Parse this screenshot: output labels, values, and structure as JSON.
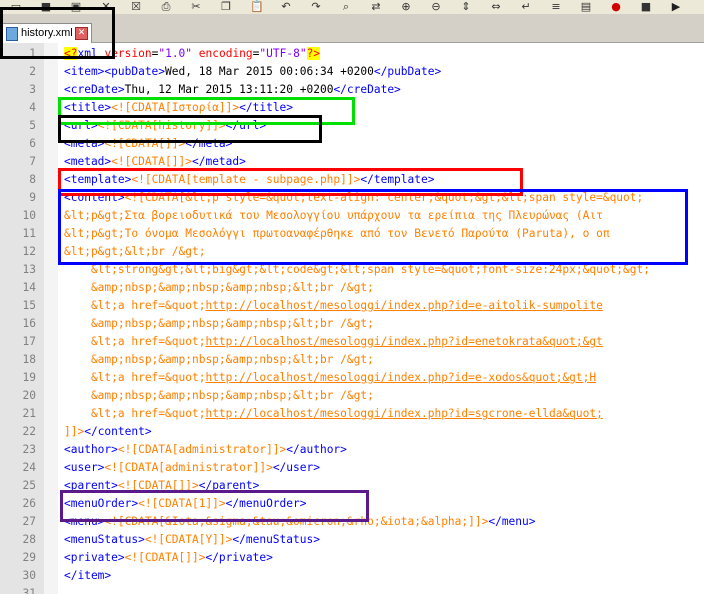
{
  "tab": {
    "label": "history.xml",
    "close": "✕"
  },
  "toolbar": {
    "icons": [
      "folder-icon",
      "save-icon",
      "save-all-icon",
      "close-icon",
      "close-all-icon",
      "print-icon",
      "cut-icon",
      "copy-icon",
      "paste-icon",
      "undo-icon",
      "redo-icon",
      "find-icon",
      "replace-icon",
      "zoom-in-icon",
      "zoom-out-icon",
      "sync-v-icon",
      "sync-h-icon",
      "wrap-icon",
      "indent-icon",
      "highlight-icon",
      "record-icon",
      "stop-icon",
      "play-icon"
    ]
  },
  "lines": [
    {
      "n": "1",
      "segs": [
        [
          "pi",
          "<?"
        ],
        [
          "tag",
          "xml "
        ],
        [
          "attr",
          "version"
        ],
        [
          "txt",
          "="
        ],
        [
          "val",
          "\"1.0\" "
        ],
        [
          "attr",
          "encoding"
        ],
        [
          "txt",
          "="
        ],
        [
          "val",
          "\"UTF-8\""
        ],
        [
          "pi",
          "?>"
        ]
      ]
    },
    {
      "n": "2",
      "segs": [
        [
          "tag",
          "<item><pubDate>"
        ],
        [
          "txt",
          "Wed, 18 Mar 2015 00:06:34 +0200"
        ],
        [
          "tag",
          "</pubDate>"
        ]
      ]
    },
    {
      "n": "3",
      "segs": [
        [
          "tag",
          "<creDate>"
        ],
        [
          "txt",
          "Thu, 12 Mar 2015 13:11:20 +0200"
        ],
        [
          "tag",
          "</creDate>"
        ]
      ]
    },
    {
      "n": "4",
      "segs": [
        [
          "tag",
          "<title>"
        ],
        [
          "cd",
          "<![CDATA[Ιστορία]]>"
        ],
        [
          "tag",
          "</title>"
        ]
      ]
    },
    {
      "n": "5",
      "segs": [
        [
          "tag",
          "<url>"
        ],
        [
          "cd",
          "<![CDATA[history]]>"
        ],
        [
          "tag",
          "</url>"
        ]
      ]
    },
    {
      "n": "6",
      "segs": [
        [
          "tag",
          "<meta>"
        ],
        [
          "cd",
          "<![CDATA[]]>"
        ],
        [
          "tag",
          "</meta>"
        ]
      ]
    },
    {
      "n": "7",
      "segs": [
        [
          "tag",
          "<metad>"
        ],
        [
          "cd",
          "<![CDATA[]]>"
        ],
        [
          "tag",
          "</metad>"
        ]
      ]
    },
    {
      "n": "8",
      "segs": [
        [
          "tag",
          "<template>"
        ],
        [
          "cd",
          "<![CDATA[template - subpage.php]]>"
        ],
        [
          "tag",
          "</template>"
        ]
      ]
    },
    {
      "n": "9",
      "segs": [
        [
          "tag",
          "<content>"
        ],
        [
          "cd",
          "<![CDATA[&lt;p style=&quot;text-align: center;&quot;&gt;&lt;span style=&quot;"
        ]
      ]
    },
    {
      "n": "10",
      "segs": [
        [
          "cd",
          "&lt;p&gt;Στα βορειοδυτικά του Μεσολογγίου υπάρχουν τα ερείπια της Πλευρώνας (Αιτ"
        ]
      ]
    },
    {
      "n": "11",
      "segs": [
        [
          "cd",
          "&lt;p&gt;Το όνομα Μεσολόγγι πρωτοαναφέρθηκε από τον Βενετό Παρούτα (Paruta), ο οπ"
        ]
      ]
    },
    {
      "n": "12",
      "segs": [
        [
          "cd",
          "&lt;p&gt;&lt;br /&gt;"
        ]
      ]
    },
    {
      "n": "13",
      "segs": [
        [
          "cd",
          "    &lt;strong&gt;&lt;big&gt;&lt;code&gt;&lt;span style=&quot;font-size:24px;&quot;&gt;"
        ]
      ]
    },
    {
      "n": "14",
      "segs": [
        [
          "cd",
          "    &amp;nbsp;&amp;nbsp;&amp;nbsp;&lt;br /&gt;"
        ]
      ]
    },
    {
      "n": "15",
      "segs": [
        [
          "cd",
          "    &lt;a href=&quot;"
        ],
        [
          "link",
          "http://localhost/mesologgi/index.php?id=e-aitolik-sumpolite"
        ]
      ]
    },
    {
      "n": "16",
      "segs": [
        [
          "cd",
          "    &amp;nbsp;&amp;nbsp;&amp;nbsp;&lt;br /&gt;"
        ]
      ]
    },
    {
      "n": "17",
      "segs": [
        [
          "cd",
          "    &lt;a href=&quot;"
        ],
        [
          "link",
          "http://localhost/mesologgi/index.php?id=enetokrata&quot;&gt"
        ]
      ]
    },
    {
      "n": "18",
      "segs": [
        [
          "cd",
          "    &amp;nbsp;&amp;nbsp;&amp;nbsp;&lt;br /&gt;"
        ]
      ]
    },
    {
      "n": "19",
      "segs": [
        [
          "cd",
          "    &lt;a href=&quot;"
        ],
        [
          "link",
          "http://localhost/mesologgi/index.php?id=e-xodos&quot;&gt;H"
        ]
      ]
    },
    {
      "n": "20",
      "segs": [
        [
          "cd",
          "    &amp;nbsp;&amp;nbsp;&amp;nbsp;&lt;br /&gt;"
        ]
      ]
    },
    {
      "n": "21",
      "segs": [
        [
          "cd",
          "    &lt;a href=&quot;"
        ],
        [
          "link",
          "http://localhost/mesologgi/index.php?id=sgcrone-ellda&quot;"
        ]
      ]
    },
    {
      "n": "22",
      "segs": [
        [
          "cd",
          "]]>"
        ],
        [
          "tag",
          "</content>"
        ]
      ]
    },
    {
      "n": "23",
      "segs": [
        [
          "tag",
          "<author>"
        ],
        [
          "cd",
          "<![CDATA[administrator]]>"
        ],
        [
          "tag",
          "</author>"
        ]
      ]
    },
    {
      "n": "24",
      "segs": [
        [
          "tag",
          "<user>"
        ],
        [
          "cd",
          "<![CDATA[administrator]]>"
        ],
        [
          "tag",
          "</user>"
        ]
      ]
    },
    {
      "n": "25",
      "segs": [
        [
          "tag",
          "<parent>"
        ],
        [
          "cd",
          "<![CDATA[]]>"
        ],
        [
          "tag",
          "</parent>"
        ]
      ]
    },
    {
      "n": "26",
      "segs": [
        [
          "tag",
          "<menuOrder>"
        ],
        [
          "cd",
          "<![CDATA[1]]>"
        ],
        [
          "tag",
          "</menuOrder>"
        ]
      ]
    },
    {
      "n": "27",
      "segs": [
        [
          "tag",
          "<menu>"
        ],
        [
          "cd",
          "<![CDATA[&Iota;&sigma;&tau;&omicron;&rho;&iota;&alpha;]]>"
        ],
        [
          "tag",
          "</menu>"
        ]
      ]
    },
    {
      "n": "28",
      "segs": [
        [
          "tag",
          "<menuStatus>"
        ],
        [
          "cd",
          "<![CDATA[Y]]>"
        ],
        [
          "tag",
          "</menuStatus>"
        ]
      ]
    },
    {
      "n": "29",
      "segs": [
        [
          "tag",
          "<private>"
        ],
        [
          "cd",
          "<![CDATA[]]>"
        ],
        [
          "tag",
          "</private>"
        ]
      ]
    },
    {
      "n": "30",
      "segs": [
        [
          "tag",
          "</item>"
        ]
      ]
    },
    {
      "n": "31",
      "segs": []
    }
  ],
  "highlight_colors": {
    "green": "#00e000",
    "black": "#000000",
    "red": "#ff0000",
    "blue": "#0000ff",
    "purple": "#5a1a8c"
  }
}
